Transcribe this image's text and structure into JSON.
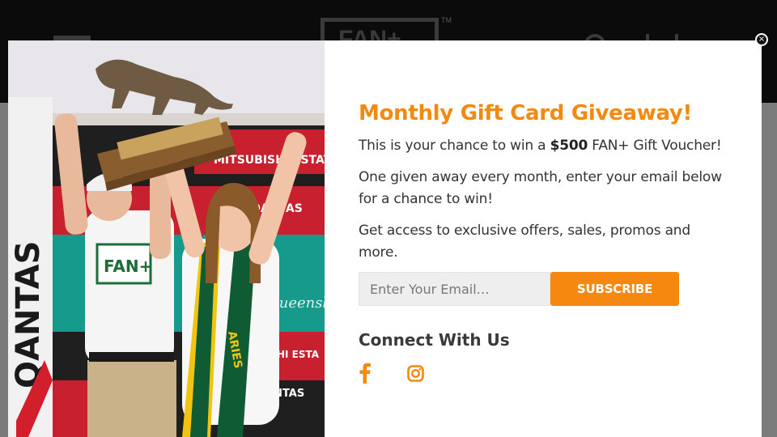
{
  "background_site": {
    "logo_text": "FAN+",
    "trademark": "TM"
  },
  "modal": {
    "title": "Monthly Gift Card Giveaway!",
    "line1_before": "This is your chance to win a ",
    "line1_amount": "$500",
    "line1_after": " FAN+ Gift Voucher!",
    "line2": "One given away every month, enter your email below for a chance to win!",
    "line3": "Get access to exclusive offers, sales, promos and more.",
    "email_placeholder": "Enter Your Email…",
    "subscribe_label": "SUBSCRIBE",
    "connect_heading": "Connect With Us",
    "close_label": "×",
    "social": [
      "facebook-icon",
      "instagram-icon"
    ],
    "accent_color": "#f38a10",
    "photo_signage": [
      "QANTAS",
      "MITSUBISHI ESTATE",
      "QANTAS",
      "UBISHI ESTA",
      "ANTAS",
      "Queensland"
    ],
    "shirt_text": "FAN+",
    "scarf_text": "ARIES"
  }
}
